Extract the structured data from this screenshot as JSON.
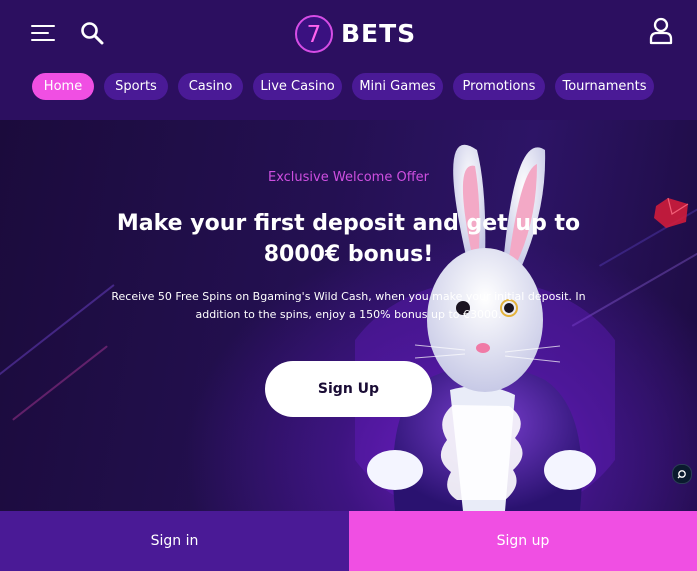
{
  "header": {
    "logo_number": "7",
    "logo_text": "BETS",
    "menu_icon": "hamburger-menu-icon",
    "search_icon": "search-icon",
    "user_icon": "user-icon"
  },
  "nav": {
    "tabs": [
      {
        "label": "Home",
        "active": true
      },
      {
        "label": "Sports",
        "active": false
      },
      {
        "label": "Casino",
        "active": false
      },
      {
        "label": "Live Casino",
        "active": false
      },
      {
        "label": "Mini Games",
        "active": false
      },
      {
        "label": "Promotions",
        "active": false
      },
      {
        "label": "Tournaments",
        "active": false
      }
    ]
  },
  "hero": {
    "label": "Exclusive Welcome Offer",
    "title": "Make your first deposit and get up to 8000€ bonus!",
    "body": "Receive 50 Free Spins on Bgaming's Wild Cash, when you make your initial deposit. In addition to the spins, enjoy a 150% bonus up to €3000.",
    "cta_label": "Sign Up",
    "illustration": "white-rabbit-illustration"
  },
  "bottom": {
    "signin_label": "Sign in",
    "signup_label": "Sign up"
  },
  "colors": {
    "header_bg": "#2c0f60",
    "tab_bg": "#4a1a96",
    "accent_pink": "#f04fe3",
    "hero_label": "#ce4fe0"
  }
}
